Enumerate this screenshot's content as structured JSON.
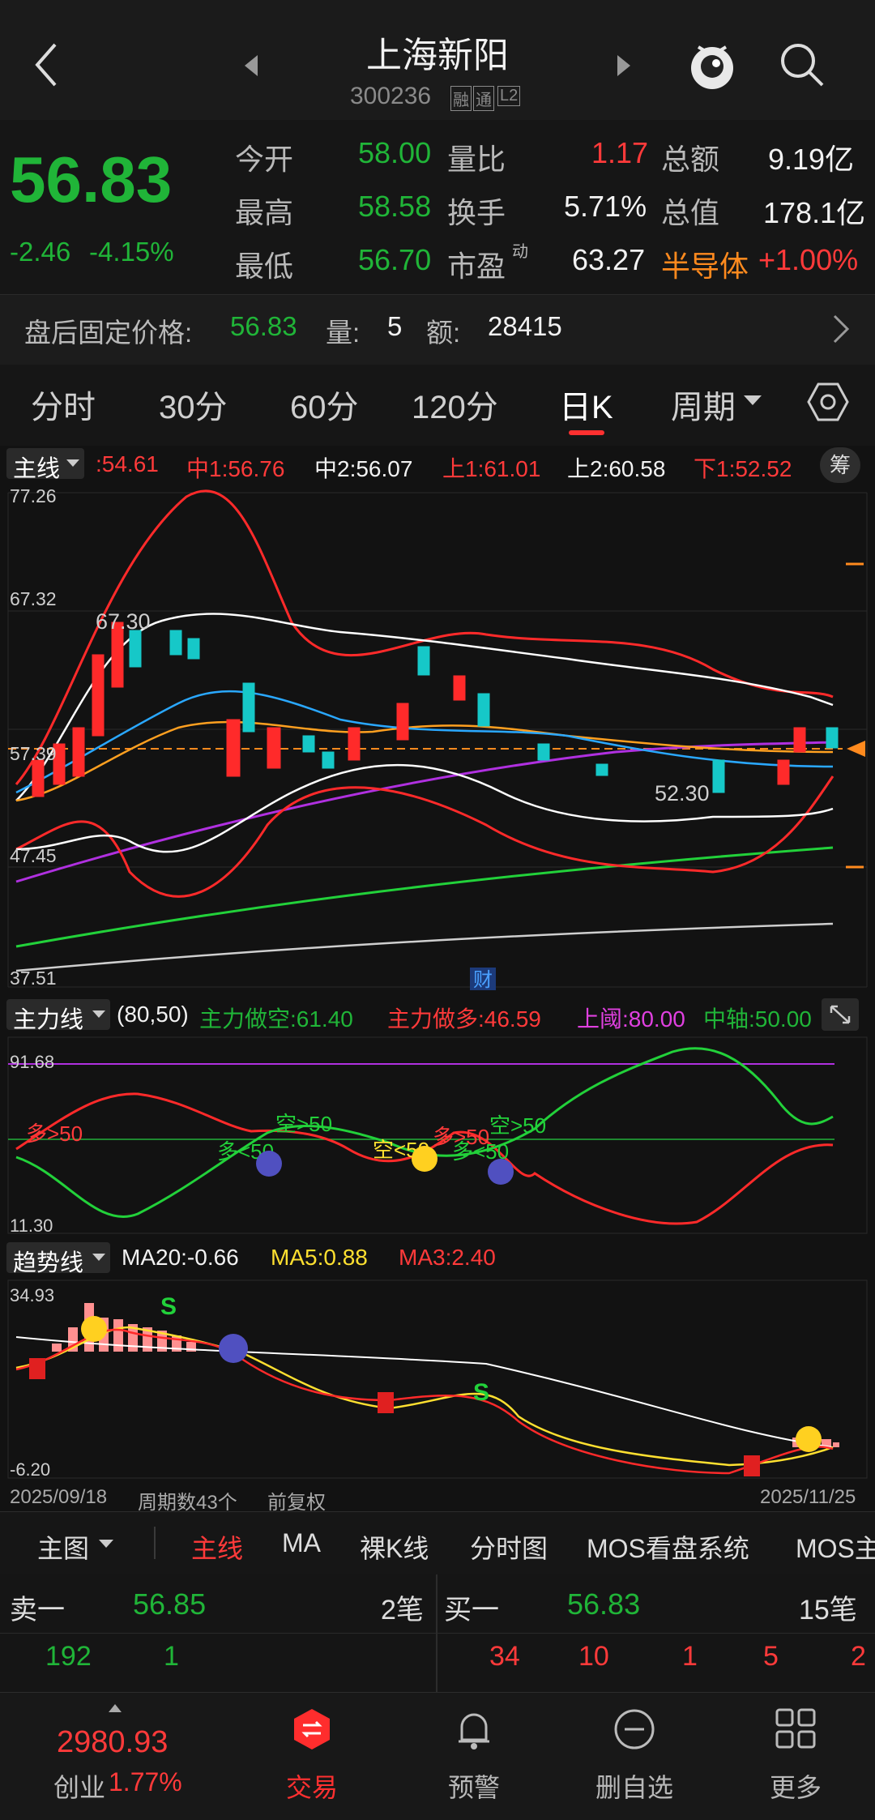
{
  "header": {
    "title": "上海新阳",
    "code": "300236",
    "badge1": "融",
    "badge2": "通",
    "badge3": "L2"
  },
  "quote": {
    "price": "56.83",
    "change": "-2.46",
    "change_pct": "-4.15%",
    "rows": [
      {
        "l1": "今开",
        "v1": "58.00",
        "l2": "量比",
        "v2": "1.17",
        "l3": "总额",
        "v3": "9.19亿"
      },
      {
        "l1": "最高",
        "v1": "58.58",
        "l2": "换手",
        "v2": "5.71%",
        "l3": "总值",
        "v3": "178.1亿"
      },
      {
        "l1": "最低",
        "v1": "56.70",
        "l2": "市盈",
        "l2sup": "动",
        "v2": "63.27",
        "l3": "半导体",
        "v3": "+1.00%"
      }
    ]
  },
  "post": {
    "label": "盘后固定价格:",
    "price": "56.83",
    "vol_label": "量:",
    "vol": "5",
    "amt_label": "额:",
    "amt": "28415"
  },
  "tabs": [
    "分时",
    "30分",
    "60分",
    "120分",
    "日K",
    "周期"
  ],
  "main_legend": {
    "name": "主线",
    "v0": ":54.61",
    "mid1": "中1:56.76",
    "mid2": "中2:56.07",
    "up1": "上1:61.01",
    "up2": "上2:60.58",
    "dn1": "下1:52.52",
    "btn": "筹"
  },
  "price_axis": {
    "top": "77.26",
    "l2": "67.32",
    "l3": "57.39",
    "l4": "47.45",
    "bottom": "37.51",
    "hi_label": "67.30",
    "lo_label": "52.30",
    "marker": "财"
  },
  "ind1": {
    "name": "主力线",
    "params": "(80,50)",
    "short": "主力做空:61.40",
    "long": "主力做多:46.59",
    "upper": "上阈:80.00",
    "axis": "中轴:50.00",
    "top": "91.68",
    "bottom": "11.30",
    "labels": [
      "多>50",
      "空>50",
      "多<50",
      "空<50",
      "多>50",
      "空>50",
      "多<50"
    ]
  },
  "ind2": {
    "name": "趋势线",
    "ma20": "MA20:-0.66",
    "ma5": "MA5:0.88",
    "ma3": "MA3:2.40",
    "top": "34.93",
    "bottom": "-6.20",
    "s": "S"
  },
  "footer_axis": {
    "start": "2025/09/18",
    "count": "周期数43个",
    "adj": "前复权",
    "end": "2025/11/25"
  },
  "subbar": {
    "main": "主图",
    "items": [
      "主线",
      "MA",
      "裸K线",
      "分时图",
      "MOS看盘系统",
      "MOS主"
    ]
  },
  "orderbook": {
    "sell_label": "卖一",
    "sell_price": "56.85",
    "sell_count": "2笔",
    "sell_q": [
      "192",
      "1"
    ],
    "buy_label": "买一",
    "buy_price": "56.83",
    "buy_count": "15笔",
    "buy_q": [
      "34",
      "10",
      "1",
      "5",
      "2"
    ]
  },
  "bottom_nav": {
    "index_value": "2980.93",
    "index_name": "创业",
    "index_pct": "1.77%",
    "items": [
      "交易",
      "预警",
      "删自选",
      "更多"
    ]
  },
  "colors": {
    "up": "#ff3a3a",
    "down": "#20b538",
    "accent": "#ff8a1e",
    "bg": "#121212"
  }
}
